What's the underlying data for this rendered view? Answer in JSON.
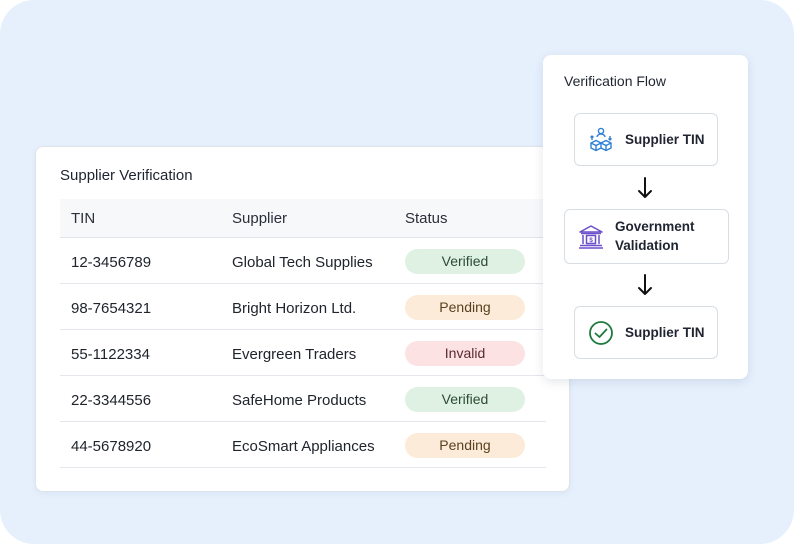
{
  "table": {
    "title": "Supplier Verification",
    "columns": [
      "TIN",
      "Supplier",
      "Status"
    ],
    "rows": [
      {
        "tin": "12-3456789",
        "supplier": "Global Tech Supplies",
        "status": "Verified"
      },
      {
        "tin": "98-7654321",
        "supplier": "Bright Horizon Ltd.",
        "status": "Pending"
      },
      {
        "tin": "55-1122334",
        "supplier": "Evergreen Traders",
        "status": "Invalid"
      },
      {
        "tin": "22-3344556",
        "supplier": "SafeHome Products",
        "status": "Verified"
      },
      {
        "tin": "44-5678920",
        "supplier": "EcoSmart Appliances",
        "status": "Pending"
      }
    ]
  },
  "flow": {
    "title": "Verification Flow",
    "steps": [
      {
        "label": "Supplier TIN",
        "icon": "supplier-boxes-icon"
      },
      {
        "label_line1": "Government",
        "label_line2": "Validation",
        "icon": "government-bank-icon"
      },
      {
        "label": "Supplier TIN",
        "icon": "check-circle-icon"
      }
    ]
  },
  "colors": {
    "background": "#e6f0fd",
    "verified_bg": "#dff1e2",
    "pending_bg": "#fdebd9",
    "invalid_bg": "#fde2e4",
    "icon_blue": "#2f7fd6",
    "icon_purple": "#6b4fc9",
    "icon_green": "#1e7a3c"
  }
}
